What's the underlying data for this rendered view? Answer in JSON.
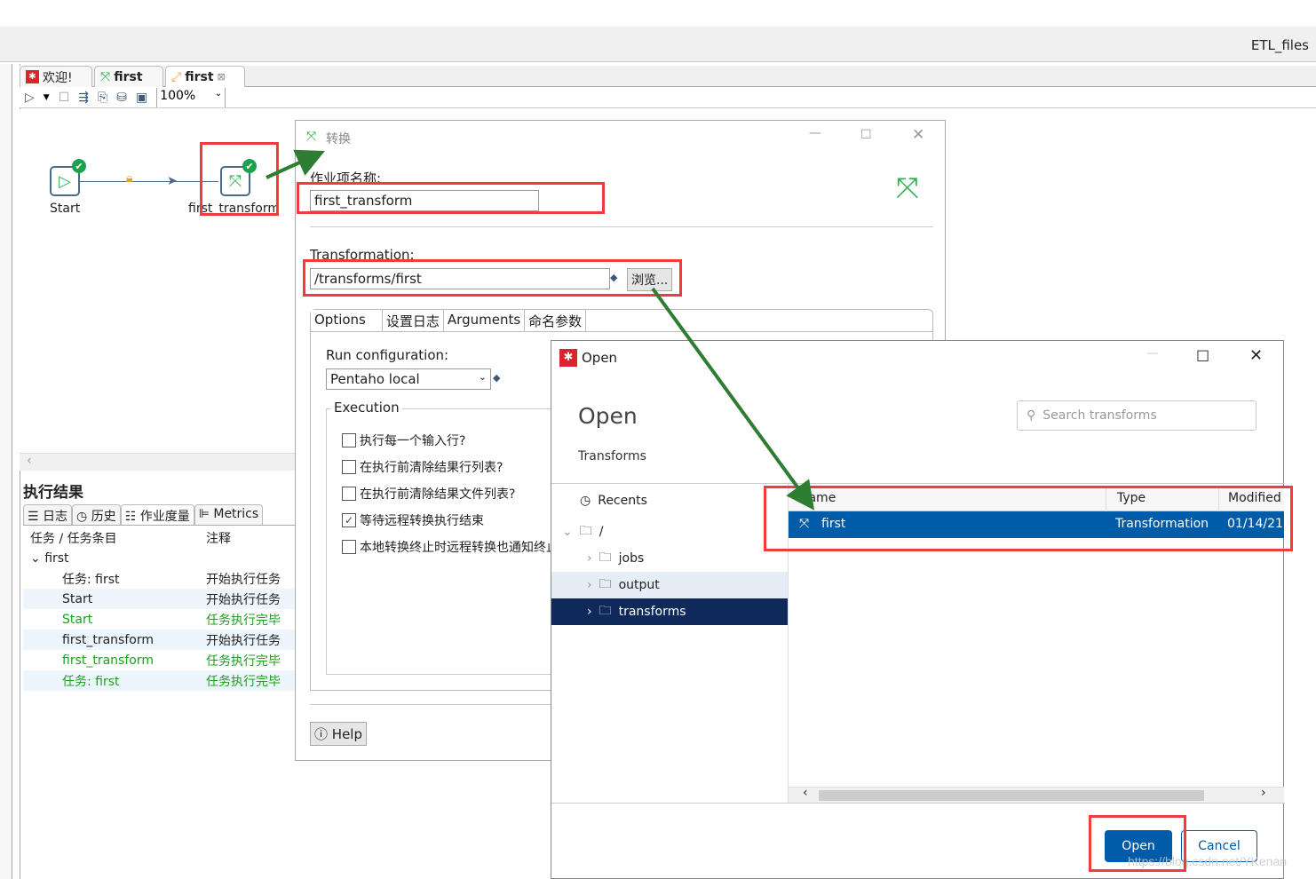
{
  "app": {
    "project": "ETL_files"
  },
  "tabs": [
    {
      "label": "欢迎!"
    },
    {
      "label": "first"
    },
    {
      "label": "first"
    }
  ],
  "toolbar": {
    "zoom": "100%"
  },
  "canvas": {
    "nodes": [
      {
        "label": "Start"
      },
      {
        "label": "first_transform"
      }
    ]
  },
  "results": {
    "title": "执行结果",
    "tabs": [
      "日志",
      "历史",
      "作业度量",
      "Metrics"
    ],
    "columns": [
      "任务 / 任务条目",
      "注释"
    ],
    "group": "first",
    "rows": [
      {
        "entry": "任务: first",
        "comment": "开始执行任务",
        "status": "start"
      },
      {
        "entry": "Start",
        "comment": "开始执行任务",
        "status": "start"
      },
      {
        "entry": "Start",
        "comment": "任务执行完毕",
        "status": "done"
      },
      {
        "entry": "first_transform",
        "comment": "开始执行任务",
        "status": "start"
      },
      {
        "entry": "first_transform",
        "comment": "任务执行完毕",
        "status": "done"
      },
      {
        "entry": "任务: first",
        "comment": "任务执行完毕",
        "status": "done"
      }
    ]
  },
  "transform_dialog": {
    "title": "转换",
    "name_label": "作业项名称:",
    "name_value": "first_transform",
    "transformation_label": "Transformation:",
    "transformation_value": "/transforms/first",
    "browse": "浏览...",
    "tabs": [
      "Options",
      "设置日志",
      "Arguments",
      "命名参数"
    ],
    "run_config_label": "Run configuration:",
    "run_config_value": "Pentaho local",
    "execution_label": "Execution",
    "checkboxes": [
      {
        "label": "执行每一个输入行?",
        "checked": false
      },
      {
        "label": "在执行前清除结果行列表?",
        "checked": false
      },
      {
        "label": "在执行前清除结果文件列表?",
        "checked": false
      },
      {
        "label": "等待远程转换执行结束",
        "checked": true
      },
      {
        "label": "本地转换终止时远程转换也通知终止",
        "checked": false
      }
    ],
    "help": "Help"
  },
  "open_dialog": {
    "title": "Open",
    "heading": "Open",
    "subheading": "Transforms",
    "search_placeholder": "Search transforms",
    "tree": [
      {
        "label": "Recents"
      },
      {
        "label": "/"
      },
      {
        "label": "jobs"
      },
      {
        "label": "output"
      },
      {
        "label": "transforms"
      }
    ],
    "columns": [
      "Name",
      "Type",
      "Modified"
    ],
    "files": [
      {
        "name": "first",
        "type": "Transformation",
        "modified": "01/14/21"
      }
    ],
    "open_button": "Open",
    "cancel_button": "Cancel"
  },
  "watermark": "https://blog.csdn.net/YKenan",
  "colors": {
    "accent": "#005ca8",
    "selected_folder": "#0f2a5a",
    "annotation_red": "#f03c3c",
    "annotation_arrow": "#2e7d32",
    "success": "#1e9e1e"
  }
}
